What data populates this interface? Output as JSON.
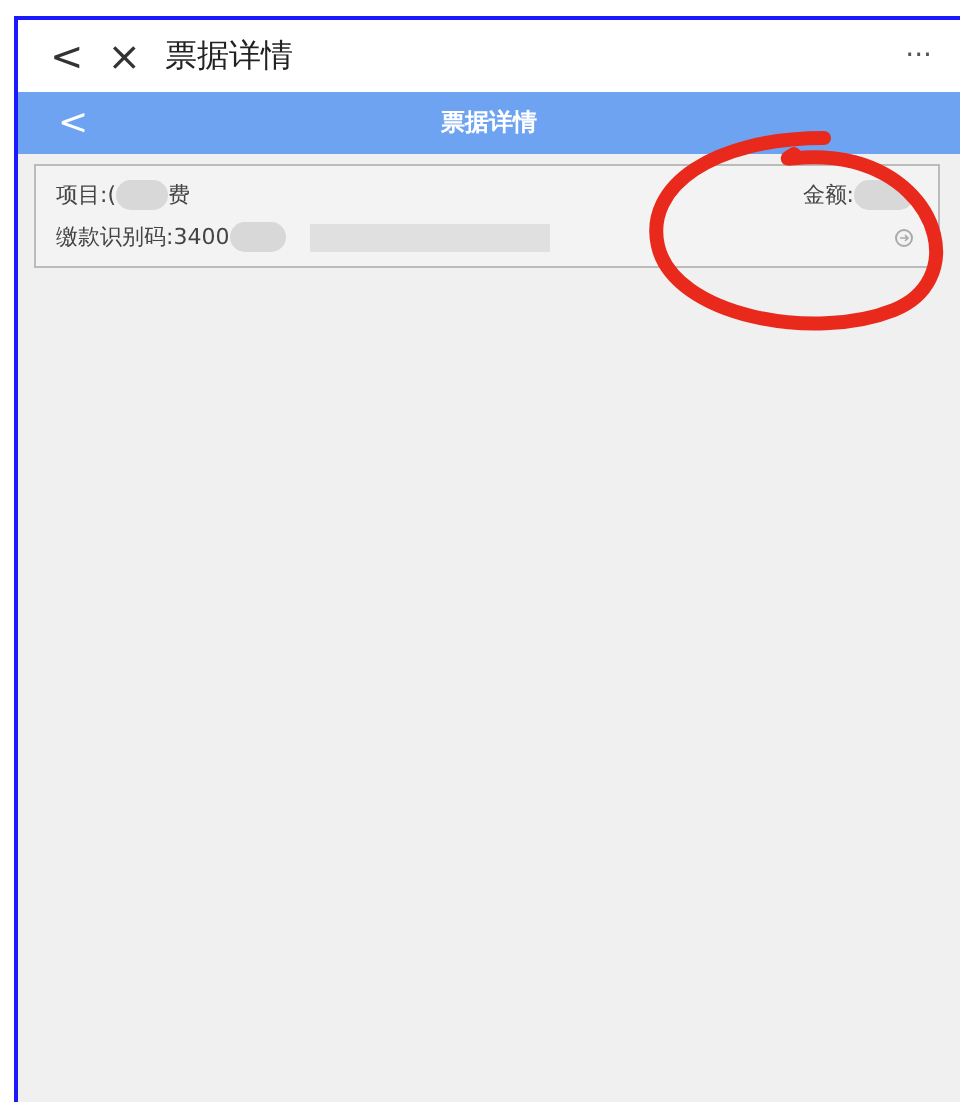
{
  "top_bar": {
    "back": "<",
    "close": "×",
    "title": "票据详情",
    "more": "···"
  },
  "header": {
    "back": "<",
    "title": "票据详情"
  },
  "bill": {
    "item_label": "项目:(",
    "item_suffix": "费",
    "amount_label": "金额:",
    "code_label": "缴款识别码:3400"
  }
}
